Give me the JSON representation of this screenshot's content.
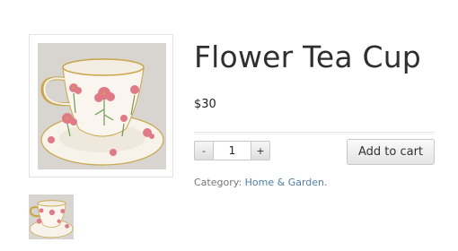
{
  "product": {
    "title": "Flower Tea Cup",
    "price": "$30",
    "main_image_alt": "teacup-photo",
    "thumbnail_alt": "teacup-thumbnail"
  },
  "cart_form": {
    "minus_label": "-",
    "plus_label": "+",
    "quantity_value": "1",
    "add_to_cart_label": "Add to cart"
  },
  "meta": {
    "category_label": "Category:",
    "category_link": "Home & Garden",
    "trailing": "."
  },
  "colors": {
    "link": "#4f7fa8",
    "title": "#2f2f2f",
    "photo_background": "#d6d3cf",
    "cup_pink": "#e07a86"
  }
}
